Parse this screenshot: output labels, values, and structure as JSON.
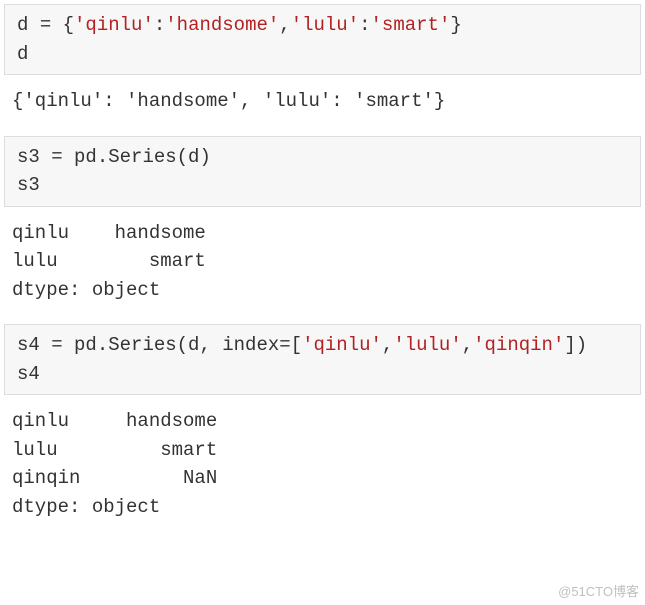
{
  "cell1": {
    "t1": "d ",
    "t2": "=",
    "t3": " {",
    "t4": "'qinlu'",
    "t5": ":",
    "t6": "'handsome'",
    "t7": ",",
    "t8": "'lulu'",
    "t9": ":",
    "t10": "'smart'",
    "t11": "}",
    "line2": "d"
  },
  "out1": "{'qinlu': 'handsome', 'lulu': 'smart'}",
  "cell2": {
    "t1": "s3 ",
    "t2": "=",
    "t3": " pd.Series(d)",
    "line2": "s3"
  },
  "out2": "qinlu    handsome\nlulu        smart\ndtype: object",
  "cell3": {
    "t1": "s4 ",
    "t2": "=",
    "t3": " pd.Series(d, index",
    "t4": "=",
    "t5": "[",
    "t6": "'qinlu'",
    "t7": ",",
    "t8": "'lulu'",
    "t9": ",",
    "t10": "'qinqin'",
    "t11": "])",
    "line2": "s4"
  },
  "out3": "qinlu     handsome\nlulu         smart\nqinqin         NaN\ndtype: object",
  "watermark": "@51CTO博客"
}
